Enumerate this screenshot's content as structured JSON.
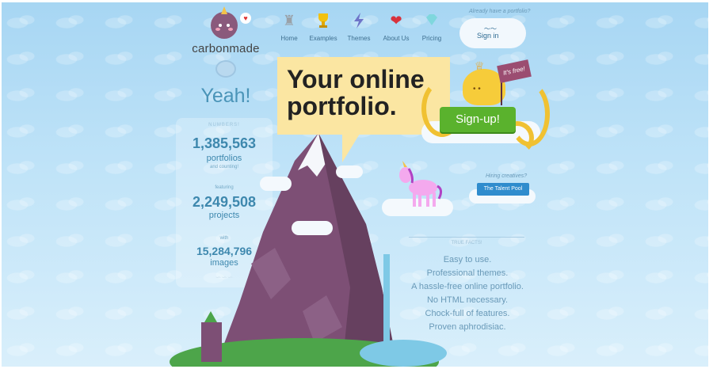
{
  "brand": {
    "name": "carbonmade"
  },
  "nav": [
    {
      "label": "Home",
      "icon": "castle-icon"
    },
    {
      "label": "Examples",
      "icon": "trophy-icon"
    },
    {
      "label": "Themes",
      "icon": "lightning-icon"
    },
    {
      "label": "About Us",
      "icon": "heart-icon"
    },
    {
      "label": "Pricing",
      "icon": "diamond-icon"
    }
  ],
  "signin": {
    "prompt": "Already have a portfolio?",
    "label": "Sign in"
  },
  "hero": {
    "exclaim": "Yeah!",
    "headline": "Your online portfolio.",
    "cta": "Sign-up!",
    "flag": "It's free!"
  },
  "stats": {
    "header": "NUMBERS!",
    "portfolios_count": "1,385,563",
    "portfolios_label": "portfolios",
    "portfolios_sub": "and counting!",
    "featuring_label": "featuring",
    "projects_count": "2,249,508",
    "projects_label": "projects",
    "with_label": "with",
    "images_count": "15,284,796",
    "images_label": "images"
  },
  "hiring": {
    "prompt": "Hiring creatives?",
    "button": "The Talent Pool"
  },
  "facts": {
    "title": "TRUE FACTS!",
    "items": [
      "Easy to use.",
      "Professional themes.",
      "A hassle-free online portfolio.",
      "No HTML necessary.",
      "Chock-full of features.",
      "Proven aphrodisiac."
    ]
  },
  "colors": {
    "sky": "#bfe3f8",
    "speech_bubble": "#fbe6a2",
    "signup_green": "#5ab22d",
    "talent_blue": "#2f8ccd",
    "mountain": "#7d4f75",
    "text_blue": "#3e88ae"
  }
}
